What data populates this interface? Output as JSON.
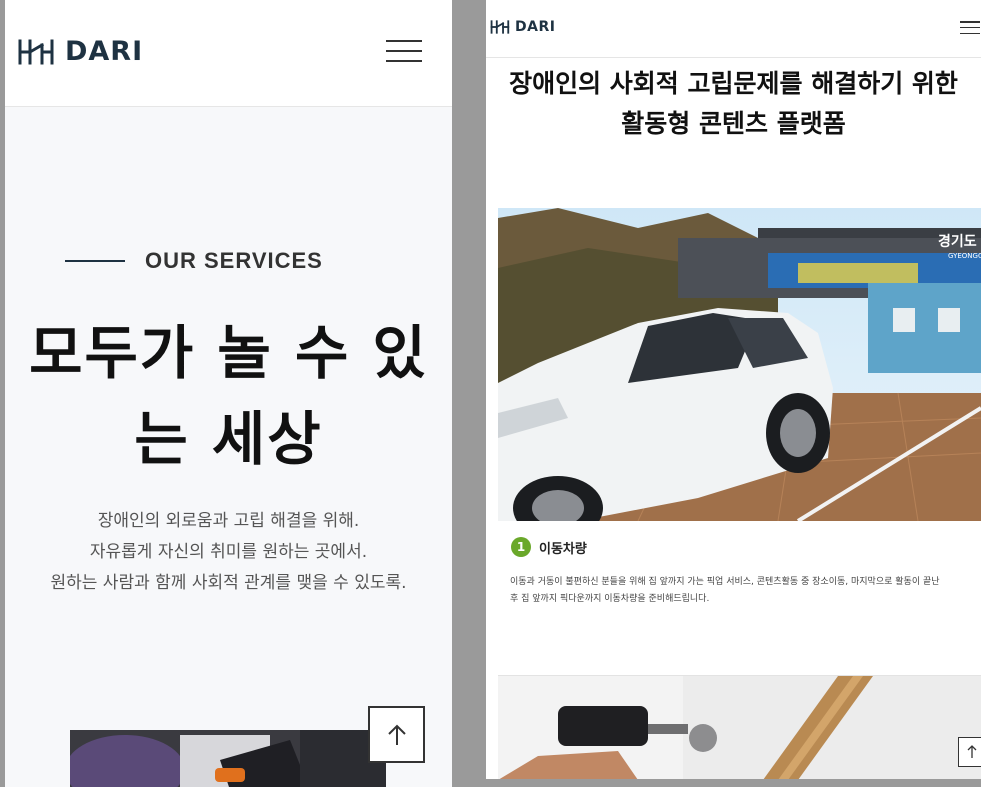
{
  "brand": {
    "logo_text": "DARI",
    "color": "#1e3242"
  },
  "left": {
    "services_label": "OUR SERVICES",
    "hero_title": [
      "모두가 놀 수 있",
      "는 세상"
    ],
    "hero_desc": [
      "장애인의 외로움과 고립 해결을 위해.",
      "자유롭게 자신의 취미를 원하는 곳에서.",
      "원하는 사람과 함께 사회적 관계를 맺을 수 있도록."
    ],
    "top_button_icon": "arrow-up-icon"
  },
  "right": {
    "page_title": [
      "장애인의 사회적 고립문제를 해결하기 위한",
      "활동형 콘텐츠 플랫폼"
    ],
    "card": {
      "number": "1",
      "title": "이동차량",
      "desc": [
        "이동과 거동이 불편하신 분들을 위해 집 앞까지 가는 픽업 서비스, 콘텐츠활동 중 장소이동, 마지막으로 활동이 끝난",
        "후 집 앞까지 픽다운까지 이동차량을 준비해드립니다."
      ],
      "badge_color": "#6aa82a"
    },
    "photo1_sign": "경기도",
    "photo1_sign_sub": "GYEONGG",
    "top_button_icon": "arrow-up-icon"
  }
}
